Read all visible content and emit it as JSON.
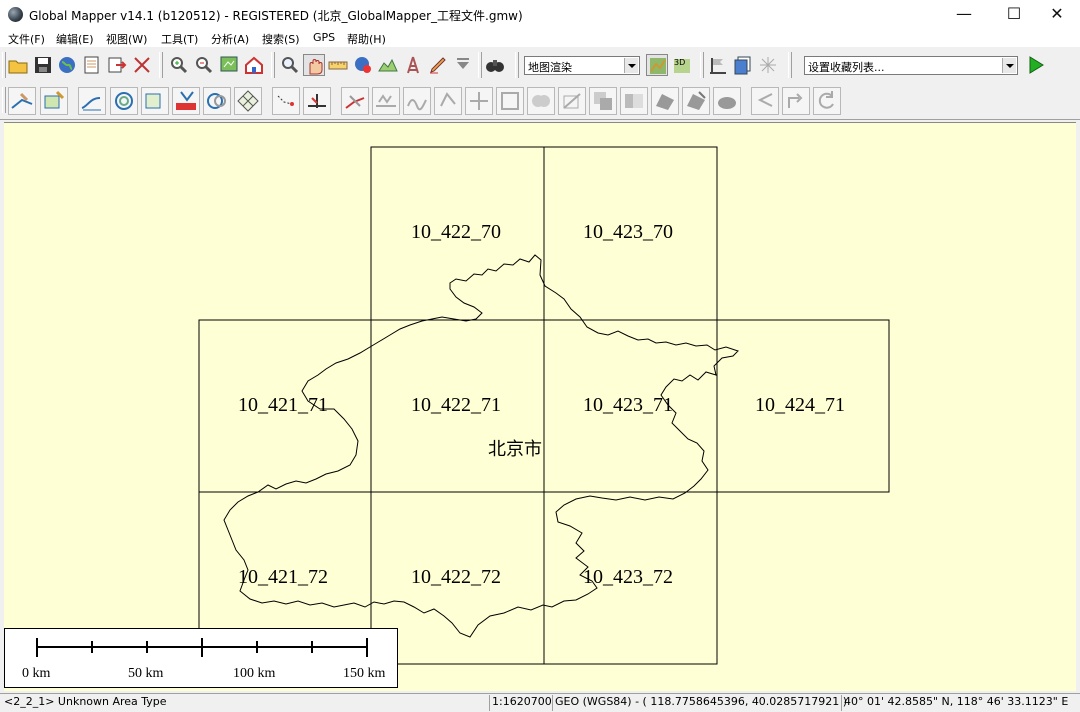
{
  "window": {
    "title": "Global Mapper v14.1 (b120512) - REGISTERED (北京_GlobalMapper_工程文件.gmw)",
    "controls": {
      "minimize": "—",
      "maximize": "☐",
      "close": "✕"
    }
  },
  "menu": {
    "items": [
      "文件(F)",
      "编辑(E)",
      "视图(W)",
      "工具(T)",
      "分析(A)",
      "搜索(S)",
      "GPS",
      "帮助(H)"
    ]
  },
  "toolbar": {
    "render_mode": "地图渲染",
    "favorites": "设置收藏列表..."
  },
  "map": {
    "tiles": [
      {
        "label": "10_422_70"
      },
      {
        "label": "10_423_70"
      },
      {
        "label": "10_421_71"
      },
      {
        "label": "10_422_71"
      },
      {
        "label": "10_423_71"
      },
      {
        "label": "10_424_71"
      },
      {
        "label": "10_421_72"
      },
      {
        "label": "10_422_72"
      },
      {
        "label": "10_423_72"
      }
    ],
    "city_label": "北京市",
    "background_color": "#ffffd6"
  },
  "scalebar": {
    "labels": [
      "0 km",
      "50 km",
      "100 km",
      "150 km"
    ]
  },
  "status": {
    "feature": "<2_2_1> Unknown Area Type",
    "scale": "1:1620700",
    "projection": "GEO (WGS84) - ( 118.7758645396, 40.0285717921 )",
    "coords": "40° 01' 42.8585\" N, 118° 46' 33.1123\" E"
  }
}
